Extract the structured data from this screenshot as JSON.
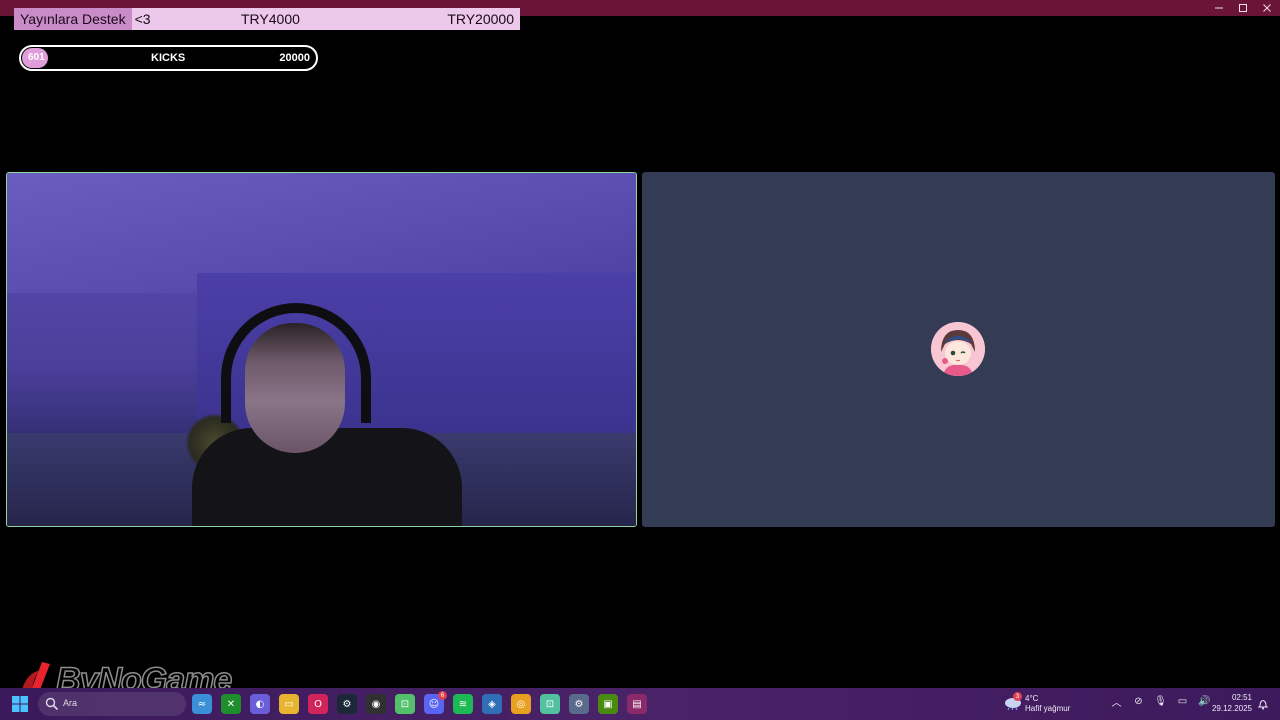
{
  "window": {
    "controls": [
      "minimize",
      "maximize",
      "close"
    ]
  },
  "goal": {
    "title": "Yayınlara Destek",
    "subtitle": "<3",
    "current": "TRY4000",
    "target": "TRY20000",
    "progress_fraction": 0.2
  },
  "kicks": {
    "count": "601",
    "label": "KICKS",
    "target": "20000",
    "progress_fraction": 0.03
  },
  "tiles": {
    "camera": {
      "speaking": true,
      "border_color": "#8ed6a0"
    },
    "avatar": {
      "background": "#343b54"
    }
  },
  "watermark": {
    "text": "ByNoGame"
  },
  "taskbar": {
    "search_placeholder": "Ara",
    "apps": [
      {
        "name": "widgets",
        "color": "#3a8fd8",
        "glyph": "≈"
      },
      {
        "name": "xbox",
        "color": "#1f8f2e",
        "glyph": "✕"
      },
      {
        "name": "copilot",
        "color": "#6a5fd8",
        "glyph": "◐"
      },
      {
        "name": "file-explorer",
        "color": "#e6b431",
        "glyph": "▭"
      },
      {
        "name": "opera",
        "color": "#d0245a",
        "glyph": "O"
      },
      {
        "name": "steam",
        "color": "#1b2838",
        "glyph": "⚙"
      },
      {
        "name": "obs",
        "color": "#303030",
        "glyph": "◉"
      },
      {
        "name": "kick",
        "color": "#53c16c",
        "glyph": "⊡"
      },
      {
        "name": "discord",
        "color": "#5865f2",
        "glyph": "☺",
        "badge": "6"
      },
      {
        "name": "spotify",
        "color": "#1db954",
        "glyph": "≋"
      },
      {
        "name": "network-app",
        "color": "#2f6fb8",
        "glyph": "◈"
      },
      {
        "name": "chrome",
        "color": "#e8a020",
        "glyph": "◎"
      },
      {
        "name": "discord-ptb",
        "color": "#53c1a0",
        "glyph": "⊡"
      },
      {
        "name": "settings",
        "color": "#5a6a8a",
        "glyph": "⚙"
      },
      {
        "name": "nvidia",
        "color": "#4a8a10",
        "glyph": "▣"
      },
      {
        "name": "winrar",
        "color": "#8a2a6a",
        "glyph": "▤"
      }
    ],
    "weather": {
      "temp": "4°C",
      "desc": "Hafif yağmur",
      "badge": "3"
    },
    "tray_icons": [
      "chevron-up",
      "network-off",
      "microphone",
      "display",
      "volume"
    ],
    "clock": {
      "time": "02:51",
      "date": "29.12.2025"
    }
  }
}
